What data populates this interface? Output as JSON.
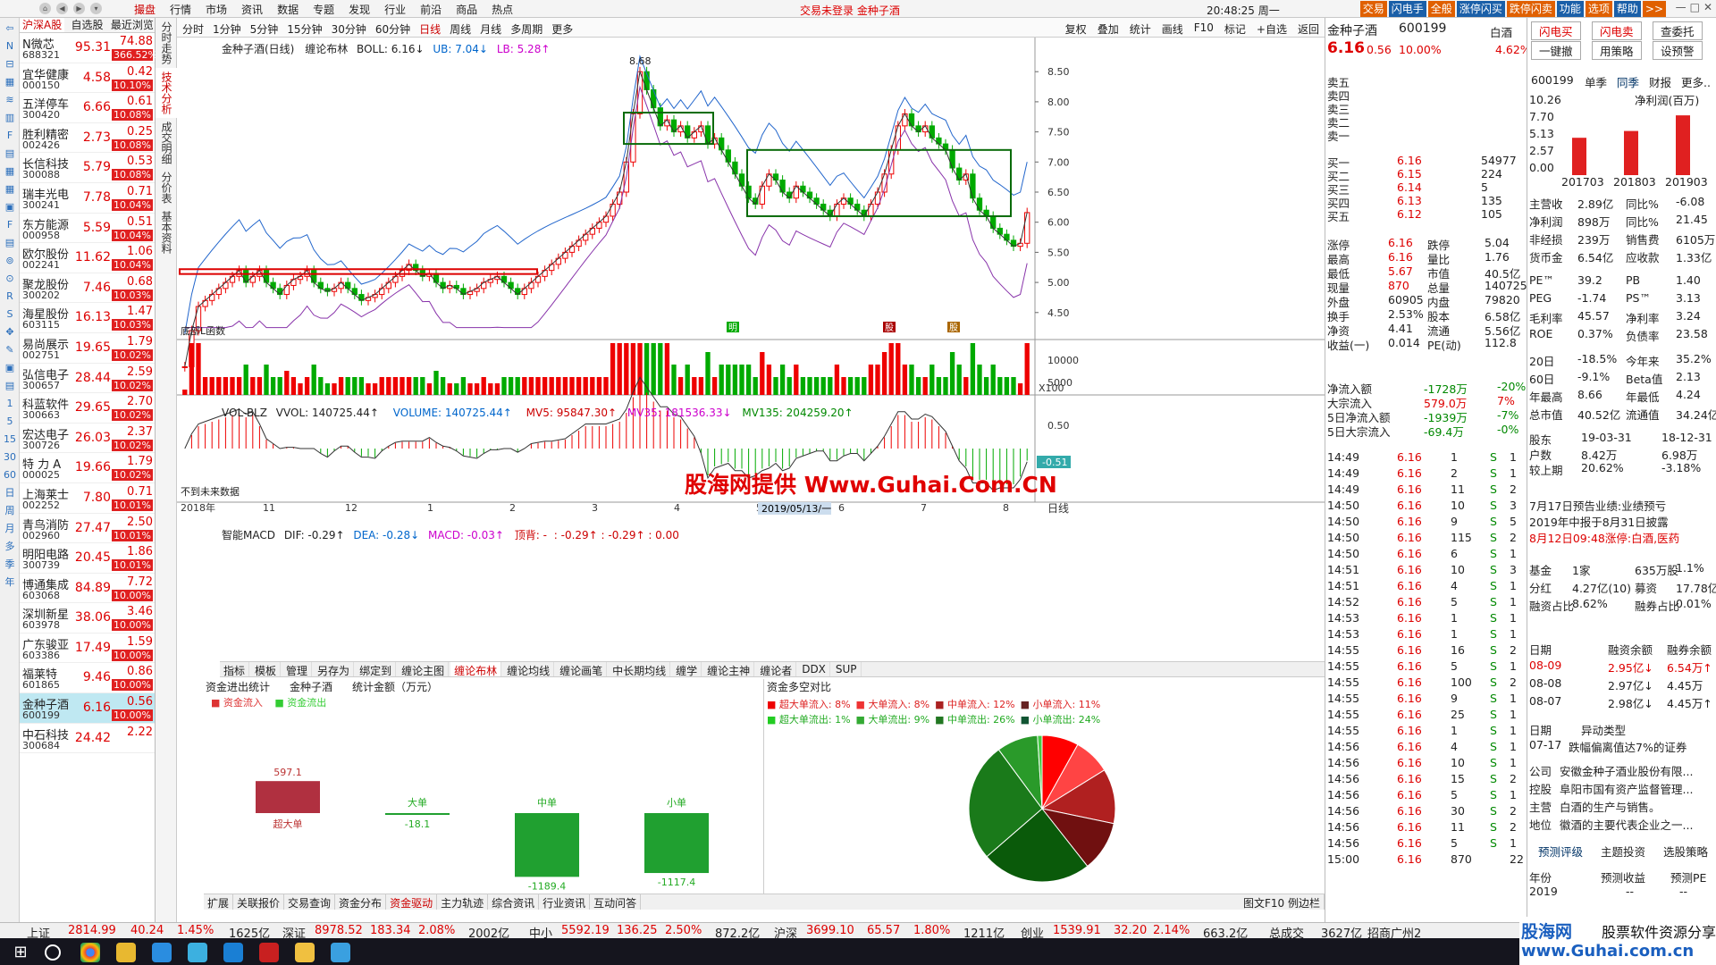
{
  "app": {
    "menu": [
      "撮盘",
      "行情",
      "市场",
      "资讯",
      "数据",
      "专题",
      "发现",
      "行业",
      "前沿",
      "商品",
      "热点"
    ],
    "active_menu": "撮盘",
    "notice": "交易未登录    金种子酒",
    "clock": "20:48:25 周一",
    "right_tabs": [
      "交易",
      "闪电手",
      "全般",
      "涨停闪买",
      "跌停闪卖",
      "功能",
      "选项",
      "帮助",
      ">>"
    ]
  },
  "left_icons": [
    "⇦",
    "N",
    "⊟",
    "▦",
    "≋",
    "▥",
    "F",
    "▤",
    "▦",
    "▦",
    "▣",
    "F",
    "▤",
    "⊚",
    "⊙",
    "R",
    "S",
    "✥",
    "✎",
    "▣",
    "▤",
    "1",
    "5",
    "15",
    "30",
    "60",
    "日",
    "周",
    "月",
    "多",
    "季",
    "年"
  ],
  "stocklist": {
    "tabs": [
      "沪深A股",
      "自选股",
      "最近浏览"
    ],
    "rows": [
      {
        "name": "N微芯",
        "code": "688321",
        "price": "95.31",
        "chg": "74.88",
        "pct": "366.52%"
      },
      {
        "name": "宜华健康",
        "code": "000150",
        "price": "4.58",
        "chg": "0.42",
        "pct": "10.10%"
      },
      {
        "name": "五洋停车",
        "code": "300420",
        "price": "6.66",
        "chg": "0.61",
        "pct": "10.08%"
      },
      {
        "name": "胜利精密",
        "code": "002426",
        "price": "2.73",
        "chg": "0.25",
        "pct": "10.08%"
      },
      {
        "name": "长信科技",
        "code": "300088",
        "price": "5.79",
        "chg": "0.53",
        "pct": "10.08%"
      },
      {
        "name": "瑞丰光电",
        "code": "300241",
        "price": "7.78",
        "chg": "0.71",
        "pct": "10.04%"
      },
      {
        "name": "东方能源",
        "code": "000958",
        "price": "5.59",
        "chg": "0.51",
        "pct": "10.04%"
      },
      {
        "name": "欧尔股份",
        "code": "002241",
        "price": "11.62",
        "chg": "1.06",
        "pct": "10.04%"
      },
      {
        "name": "聚龙股份",
        "code": "300202",
        "price": "7.46",
        "chg": "0.68",
        "pct": "10.03%"
      },
      {
        "name": "海星股份",
        "code": "603115",
        "price": "16.13",
        "chg": "1.47",
        "pct": "10.03%"
      },
      {
        "name": "易尚展示",
        "code": "002751",
        "price": "19.65",
        "chg": "1.79",
        "pct": "10.02%"
      },
      {
        "name": "弘信电子",
        "code": "300657",
        "price": "28.44",
        "chg": "2.59",
        "pct": "10.02%"
      },
      {
        "name": "科蓝软件",
        "code": "300663",
        "price": "29.65",
        "chg": "2.70",
        "pct": "10.02%"
      },
      {
        "name": "宏达电子",
        "code": "300726",
        "price": "26.03",
        "chg": "2.37",
        "pct": "10.02%"
      },
      {
        "name": "特 力 A",
        "code": "000025",
        "price": "19.66",
        "chg": "1.79",
        "pct": "10.02%"
      },
      {
        "name": "上海莱士",
        "code": "002252",
        "price": "7.80",
        "chg": "0.71",
        "pct": "10.01%"
      },
      {
        "name": "青鸟消防",
        "code": "002960",
        "price": "27.47",
        "chg": "2.50",
        "pct": "10.01%"
      },
      {
        "name": "明阳电路",
        "code": "300739",
        "price": "20.45",
        "chg": "1.86",
        "pct": "10.01%"
      },
      {
        "name": "博通集成",
        "code": "603068",
        "price": "84.89",
        "chg": "7.72",
        "pct": "10.00%"
      },
      {
        "name": "深圳新星",
        "code": "603978",
        "price": "38.06",
        "chg": "3.46",
        "pct": "10.00%"
      },
      {
        "name": "广东骏亚",
        "code": "603386",
        "price": "17.49",
        "chg": "1.59",
        "pct": "10.00%"
      },
      {
        "name": "福莱特",
        "code": "601865",
        "price": "9.46",
        "chg": "0.86",
        "pct": "10.00%"
      },
      {
        "name": "金种子酒",
        "code": "600199",
        "price": "6.16",
        "chg": "0.56",
        "pct": "10.00%"
      },
      {
        "name": "中石科技",
        "code": "300684",
        "price": "24.42",
        "chg": "2.22",
        "pct": ""
      }
    ],
    "selected_index": 22
  },
  "vtabs": [
    "分时走势",
    "技术分析",
    "成交明细",
    "分价表",
    "基本资料"
  ],
  "charttb": {
    "left": [
      "分时",
      "1分钟",
      "5分钟",
      "15分钟",
      "30分钟",
      "60分钟",
      "日线",
      "周线",
      "月线",
      "多周期",
      "更多"
    ],
    "active": "日线",
    "right": [
      "复权",
      "叠加",
      "统计",
      "画线",
      "F10",
      "标记",
      "+自选",
      "返回"
    ]
  },
  "chart": {
    "legend1": {
      "title": "金种子酒(日线)",
      "ind": "缠论布林",
      "boll": "BOLL: 6.16↓",
      "ub": "UB: 7.04↓",
      "lb": "LB: 5.28↑"
    },
    "yticks": [
      "8.50",
      "8.00",
      "7.50",
      "7.00",
      "6.50",
      "6.00",
      "5.50",
      "5.00",
      "4.50"
    ],
    "peak": "8.68",
    "low_label": "底部L函数",
    "legend2": {
      "name": "VOL-BLZ",
      "vvol": "VVOL: 140725.44↑",
      "volume": "VOLUME: 140725.44↑",
      "mv5": "MV5: 95847.30↑",
      "mv35": "MV35: 181536.33↓",
      "mv135": "MV135: 204259.20↑"
    },
    "vol_ticks": [
      "10000",
      "5000"
    ],
    "vol_unit": "X100",
    "legend3": {
      "name": "智能MACD",
      "dif": "DIF: -0.29↑",
      "dea": "DEA: -0.28↓",
      "macd": "MACD: -0.03↑",
      "top": "顶背: -",
      "sep": ": -0.29↑  : -0.29↑  : 0.00"
    },
    "macd_ticks": [
      "0.50",
      "-0.51"
    ],
    "macd_note": "不到未来数据",
    "xticks": [
      "2018年",
      "11",
      "12",
      "1",
      "2",
      "3",
      "4",
      "5",
      "6",
      "7",
      "8"
    ],
    "xdate": "2019/05/13/一",
    "period": "日线",
    "marks": [
      "明",
      "股",
      "股"
    ],
    "candles": [
      3.6,
      4.2,
      4.6,
      4.7,
      4.8,
      4.9,
      5.0,
      5.1,
      5.2,
      5.0,
      5.1,
      5.2,
      5.0,
      4.9,
      4.8,
      4.95,
      5.05,
      5.1,
      5.2,
      5.0,
      4.9,
      4.85,
      4.9,
      5.0,
      4.9,
      4.8,
      4.7,
      4.75,
      4.8,
      4.9,
      5.0,
      5.1,
      5.2,
      5.3,
      5.2,
      5.1,
      5.15,
      5.0,
      4.9,
      4.95,
      4.9,
      4.8,
      4.85,
      4.9,
      5.0,
      5.05,
      5.1,
      5.0,
      4.9,
      4.8,
      4.9,
      5.0,
      5.1,
      5.2,
      5.3,
      5.4,
      5.5,
      5.6,
      5.7,
      5.8,
      5.9,
      6.0,
      6.1,
      6.3,
      6.5,
      7.0,
      7.8,
      8.5,
      8.2,
      7.9,
      7.6,
      7.7,
      7.5,
      7.6,
      7.4,
      7.5,
      7.6,
      7.3,
      7.4,
      7.2,
      7.0,
      6.8,
      6.6,
      6.4,
      6.3,
      6.6,
      6.8,
      6.7,
      6.5,
      6.4,
      6.6,
      6.5,
      6.4,
      6.3,
      6.2,
      6.1,
      6.3,
      6.4,
      6.3,
      6.2,
      6.1,
      6.3,
      6.5,
      6.8,
      7.2,
      7.6,
      7.8,
      7.6,
      7.5,
      7.6,
      7.4,
      7.3,
      7.2,
      6.9,
      6.7,
      6.8,
      6.4,
      6.2,
      6.1,
      5.9,
      5.8,
      5.7,
      5.6,
      5.65,
      6.16
    ]
  },
  "btabs": [
    "指标",
    "模板",
    "管理",
    "另存为",
    "绑定到",
    "缠论主图",
    "缠论布林",
    "缠论均线",
    "缠论画笔",
    "中长期均线",
    "缠学",
    "缠论主神",
    "缠论者",
    "DDX",
    "SUP"
  ],
  "btabs_active": "缠论布林",
  "fund": {
    "hd": [
      "资金进出统计",
      "金种子酒",
      "统计金额（万元）"
    ],
    "legend_in": "资金流入",
    "legend_out": "资金流出",
    "cats": [
      {
        "label": "超大单",
        "value": "597.1"
      },
      {
        "label": "大单",
        "value": "-18.1"
      },
      {
        "label": "中单",
        "value": "-1189.4"
      },
      {
        "label": "小单",
        "value": "-1117.4"
      }
    ]
  },
  "pie": {
    "title": "资金多空对比",
    "in": [
      "超大单流入: 8%",
      "大单流入: 8%",
      "中单流入: 12%",
      "小单流入: 11%"
    ],
    "out": [
      "超大单流出: 1%",
      "大单流出: 9%",
      "中单流出: 26%",
      "小单流出: 24%"
    ],
    "slices": [
      8,
      8,
      12,
      11,
      24,
      26,
      9,
      1
    ]
  },
  "bottomtabs": [
    "扩展",
    "关联报价",
    "交易查询",
    "资金分布",
    "资金驱动",
    "主力轨迹",
    "综合资讯",
    "行业资讯",
    "互动问答"
  ],
  "bottomtabs_active": "资金驱动",
  "bottom_right": "图文F10  例边栏",
  "quote": {
    "name": "金种子酒",
    "code": "600199",
    "tag": "白酒",
    "price": "6.16",
    "chg": "0.56",
    "pct": "10.00%",
    "vol_ratio": "4.62%",
    "sells": [
      "卖五",
      "卖四",
      "卖三",
      "卖二",
      "卖一"
    ],
    "buys": [
      [
        "买一",
        "6.16",
        "54977"
      ],
      [
        "买二",
        "6.15",
        "224"
      ],
      [
        "买三",
        "6.14",
        "5"
      ],
      [
        "买四",
        "6.13",
        "135"
      ],
      [
        "买五",
        "6.12",
        "105"
      ]
    ],
    "stats": [
      [
        "涨停",
        "6.16",
        "跌停",
        "5.04"
      ],
      [
        "最高",
        "6.16",
        "量比",
        "1.76"
      ],
      [
        "最低",
        "5.67",
        "市值",
        "40.5亿"
      ],
      [
        "现量",
        "870",
        "总量",
        "140725"
      ],
      [
        "外盘",
        "60905",
        "内盘",
        "79820"
      ],
      [
        "换手",
        "2.53%",
        "股本",
        "6.58亿"
      ],
      [
        "净资",
        "4.41",
        "流通",
        "5.56亿"
      ],
      [
        "收益(一)",
        "0.014",
        "PE(动)",
        "112.8"
      ]
    ],
    "flows": [
      [
        "净流入额",
        "-1728万",
        "-20%"
      ],
      [
        "大宗流入",
        "579.0万",
        "7%"
      ],
      [
        "5日净流入额",
        "-1939万",
        "-7%"
      ],
      [
        "5日大宗流入",
        "-69.4万",
        "-0%"
      ]
    ],
    "ticks": [
      [
        "14:49",
        "6.16",
        "1",
        "S",
        "1"
      ],
      [
        "14:49",
        "6.16",
        "2",
        "S",
        "1"
      ],
      [
        "14:49",
        "6.16",
        "11",
        "S",
        "2"
      ],
      [
        "14:50",
        "6.16",
        "10",
        "S",
        "3"
      ],
      [
        "14:50",
        "6.16",
        "9",
        "S",
        "5"
      ],
      [
        "14:50",
        "6.16",
        "115",
        "S",
        "2"
      ],
      [
        "14:50",
        "6.16",
        "6",
        "S",
        "1"
      ],
      [
        "14:51",
        "6.16",
        "10",
        "S",
        "3"
      ],
      [
        "14:51",
        "6.16",
        "4",
        "S",
        "1"
      ],
      [
        "14:52",
        "6.16",
        "5",
        "S",
        "1"
      ],
      [
        "14:53",
        "6.16",
        "1",
        "S",
        "1"
      ],
      [
        "14:53",
        "6.16",
        "1",
        "S",
        "1"
      ],
      [
        "14:55",
        "6.16",
        "16",
        "S",
        "2"
      ],
      [
        "14:55",
        "6.16",
        "5",
        "S",
        "1"
      ],
      [
        "14:55",
        "6.16",
        "100",
        "S",
        "2"
      ],
      [
        "14:55",
        "6.16",
        "9",
        "S",
        "1"
      ],
      [
        "14:55",
        "6.16",
        "25",
        "S",
        "1"
      ],
      [
        "14:55",
        "6.16",
        "1",
        "S",
        "1"
      ],
      [
        "14:56",
        "6.16",
        "4",
        "S",
        "1"
      ],
      [
        "14:56",
        "6.16",
        "10",
        "S",
        "1"
      ],
      [
        "14:56",
        "6.16",
        "15",
        "S",
        "2"
      ],
      [
        "14:56",
        "6.16",
        "5",
        "S",
        "1"
      ],
      [
        "14:56",
        "6.16",
        "30",
        "S",
        "2"
      ],
      [
        "14:56",
        "6.16",
        "11",
        "S",
        "2"
      ],
      [
        "14:56",
        "6.16",
        "5",
        "S",
        "1"
      ],
      [
        "15:00",
        "6.16",
        "870",
        "",
        "22"
      ]
    ]
  },
  "f10": {
    "btns": [
      "闪电买",
      "闪电卖",
      "查委托",
      "一键撤",
      "用策略",
      "设预警"
    ],
    "code": "600199",
    "tabs": [
      "单季",
      "同季",
      "财报",
      "更多.."
    ],
    "chart_title": "净利润(百万)",
    "yvals": [
      "10.26",
      "7.70",
      "5.13",
      "2.57",
      "0.00"
    ],
    "bars": [
      {
        "x": "201703",
        "v": 5.5
      },
      {
        "x": "201803",
        "v": 6.5
      },
      {
        "x": "201903",
        "v": 8.8
      }
    ],
    "rows1": [
      [
        "主营收",
        "2.89亿",
        "同比%",
        "-6.08"
      ],
      [
        "净利润",
        "898万",
        "同比%",
        "21.45"
      ],
      [
        "非经损",
        "239万",
        "销售费",
        "6105万"
      ],
      [
        "货币金",
        "6.54亿",
        "应收款",
        "1.33亿"
      ]
    ],
    "rows2": [
      [
        "PE™",
        "39.2",
        "PB",
        "1.40"
      ],
      [
        "PEG",
        "-1.74",
        "PS™",
        "3.13"
      ],
      [
        "毛利率",
        "45.57",
        "净利率",
        "3.24"
      ],
      [
        "ROE",
        "0.37%",
        "负债率",
        "23.58"
      ]
    ],
    "rows3": [
      [
        "20日",
        "-18.5%",
        "今年来",
        "35.2%"
      ],
      [
        "60日",
        "-9.1%",
        "Beta值",
        "2.13"
      ],
      [
        "年最高",
        "8.66",
        "年最低",
        "4.24"
      ],
      [
        "总市值",
        "40.52亿",
        "流通值",
        "34.24亿"
      ]
    ],
    "rows4": [
      [
        "股东",
        "19-03-31",
        "",
        "18-12-31"
      ],
      [
        "户数",
        "8.42万",
        "",
        "6.98万"
      ],
      [
        "较上期",
        "20.62%",
        "",
        "-3.18%"
      ]
    ],
    "notes": [
      "7月17日预告业绩:业绩预亏",
      "2019年中报于8月31日披露",
      "8月12日09:48涨停:白酒,医药"
    ],
    "fund_rows": [
      [
        "基金",
        "1家",
        "635万股",
        "1.1%"
      ],
      [
        "分红",
        "4.27亿(10)",
        "募资",
        "17.78亿(4)"
      ],
      [
        "融资占比",
        "8.62%",
        "融券占比",
        "0.01%"
      ]
    ],
    "margin_hd": [
      "日期",
      "融资余额",
      "融券余额"
    ],
    "margin": [
      [
        "08-09",
        "2.95亿↓",
        "6.54万↑"
      ],
      [
        "08-08",
        "2.97亿↓",
        "4.45万"
      ],
      [
        "08-07",
        "2.98亿↓",
        "4.45万↑"
      ]
    ],
    "abn_hd": [
      "日期",
      "异动类型"
    ],
    "abn": [
      [
        "07-17",
        "跌幅偏离值达7%的证券"
      ]
    ],
    "company": [
      [
        "公司",
        "安徽金种子酒业股份有限..."
      ],
      [
        "控股",
        "阜阳市国有资产监督管理..."
      ],
      [
        "主营",
        "白酒的生产与销售。"
      ],
      [
        "地位",
        "徽酒的主要代表企业之一..."
      ]
    ],
    "links": [
      "预测评级",
      "主题投资",
      "选股策略"
    ],
    "fc_hd": [
      "年份",
      "预测收益",
      "预测PE"
    ],
    "fc": [
      [
        "2019",
        "--",
        "--"
      ]
    ]
  },
  "statusbar": {
    "sh_label": "上证",
    "sh": "2814.99",
    "sh_chg": "40.24",
    "sh_pct": "1.45%",
    "sh_amt": "1625亿",
    "sz_label": "深证",
    "sz": "8978.52",
    "sz_chg": "183.34",
    "sz_pct": "2.08%",
    "sz_amt": "2002亿",
    "zx_label": "中小",
    "zx": "5592.19",
    "zx_chg": "136.25",
    "zx_pct": "2.50%",
    "zx_amt": "872.2亿",
    "hs_label": "沪深",
    "hs": "3699.10",
    "hs_chg": "65.57",
    "hs_pct": "1.80%",
    "hs_amt": "1211亿",
    "cy_label": "创业",
    "cy": "1539.91",
    "cy_chg": "32.20",
    "cy_pct": "2.14%",
    "cy_amt": "663.2亿",
    "total_label": "总成交",
    "total": "3627亿",
    "broker": "招商广州2"
  },
  "watermark": "股海网提供 Www.Guhai.Com.CN",
  "watermark2": {
    "a": "股海网",
    "b": "股票软件资源分享",
    "c": "www.Guhai.com.cn"
  }
}
